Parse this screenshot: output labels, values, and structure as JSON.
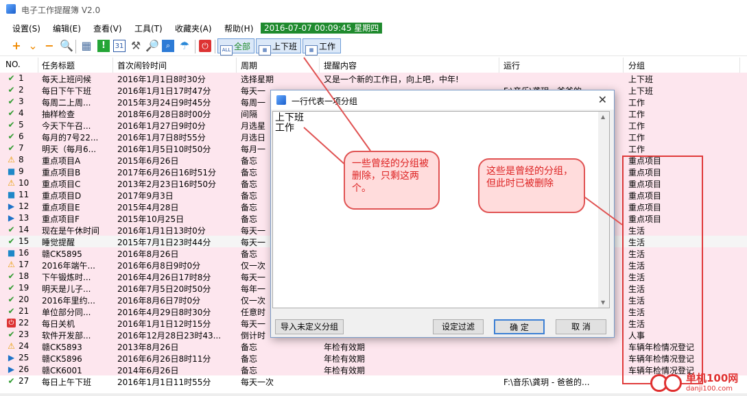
{
  "window": {
    "title": "电子工作提醒簿 V2.0"
  },
  "menu": [
    "设置(S)",
    "编辑(E)",
    "查看(V)",
    "工具(T)",
    "收藏夹(A)",
    "帮助(H)"
  ],
  "clock": "2016-07-07 00:09:45 星期四",
  "toolbar": {
    "buttons": [
      "全部",
      "上下班",
      "工作"
    ],
    "icons": [
      "add-icon",
      "dropdown-icon",
      "remove-icon",
      "search-icon",
      "calendar-icon",
      "exclamation-icon",
      "date31-icon",
      "tools-icon",
      "find-doc-icon",
      "search-blue-icon",
      "weather-icon",
      "power-icon"
    ]
  },
  "columns": [
    "NO.",
    "任务标题",
    "首次闹铃时间",
    "周期",
    "提醒内容",
    "运行",
    "分组"
  ],
  "rows": [
    {
      "no": "1",
      "status": "check",
      "title": "每天上班问候",
      "time": "2016年1月1日8时30分",
      "period": "选择星期",
      "content": "又是一个新的工作日，向上吧，中年!",
      "run": "",
      "group": "上下班"
    },
    {
      "no": "2",
      "status": "check",
      "title": "每日下午下班",
      "time": "2016年1月1日17时47分",
      "period": "每天一",
      "content": "",
      "run": "F:\\音乐\\龚玥 - 爸爸的",
      "group": "上下班"
    },
    {
      "no": "3",
      "status": "check",
      "title": "每周二上周...",
      "time": "2015年3月24日9时45分",
      "period": "每周一",
      "content": "",
      "run": "",
      "group": "工作"
    },
    {
      "no": "4",
      "status": "check",
      "title": "抽样检查",
      "time": "2018年6月28日8时00分",
      "period": "间隔",
      "content": "",
      "run": "",
      "group": "工作"
    },
    {
      "no": "5",
      "status": "check",
      "title": "今天下午召...",
      "time": "2016年1月27日9时0分",
      "period": "月选星",
      "content": "",
      "run": "",
      "group": "工作"
    },
    {
      "no": "6",
      "status": "check",
      "title": "每月的7号22...",
      "time": "2016年1月7日8时55分",
      "period": "月选日",
      "content": "",
      "run": "",
      "group": "工作"
    },
    {
      "no": "7",
      "status": "check",
      "title": "明天（每月6...",
      "time": "2016年1月5日10时50分",
      "period": "每月一",
      "content": "",
      "run": "",
      "group": "工作"
    },
    {
      "no": "8",
      "status": "warn",
      "title": "重点项目A",
      "time": "2015年6月26日",
      "period": "备忘",
      "content": "",
      "run": "",
      "group": "重点项目"
    },
    {
      "no": "9",
      "status": "square",
      "title": "重点项目B",
      "time": "2017年6月26日16时51分",
      "period": "备忘",
      "content": "",
      "run": "",
      "group": "重点项目"
    },
    {
      "no": "10",
      "status": "warn",
      "title": "重点项目C",
      "time": "2013年2月23日16时50分",
      "period": "备忘",
      "content": "",
      "run": "",
      "group": "重点项目"
    },
    {
      "no": "11",
      "status": "square",
      "title": "重点项目D",
      "time": "2017年9月3日",
      "period": "备忘",
      "content": "",
      "run": "",
      "group": "重点项目"
    },
    {
      "no": "12",
      "status": "play",
      "title": "重点项目E",
      "time": "2015年4月28日",
      "period": "备忘",
      "content": "",
      "run": "",
      "group": "重点项目"
    },
    {
      "no": "13",
      "status": "play",
      "title": "重点项目F",
      "time": "2015年10月25日",
      "period": "备忘",
      "content": "",
      "run": "",
      "group": "重点项目"
    },
    {
      "no": "14",
      "status": "check",
      "title": "现在是午休时间",
      "time": "2016年1月1日13时0分",
      "period": "每天一",
      "content": "",
      "run": "",
      "group": "生活"
    },
    {
      "no": "15",
      "status": "check",
      "title": "睡觉提醒",
      "time": "2015年7月1日23时44分",
      "period": "每天一",
      "content": "",
      "run": "",
      "group": "生活"
    },
    {
      "no": "16",
      "status": "square",
      "title": "赣CK5895",
      "time": "2016年8月26日",
      "period": "备忘",
      "content": "",
      "run": "",
      "group": "生活"
    },
    {
      "no": "17",
      "status": "warn",
      "title": "2016年端午...",
      "time": "2016年6月8日9时0分",
      "period": "仅一次",
      "content": "",
      "run": "",
      "group": "生活"
    },
    {
      "no": "18",
      "status": "check",
      "title": "下午锻炼时...",
      "time": "2016年4月26日17时8分",
      "period": "每天一",
      "content": "",
      "run": "",
      "group": "生活"
    },
    {
      "no": "19",
      "status": "check",
      "title": "明天是儿子...",
      "time": "2016年7月5日20时50分",
      "period": "每年一",
      "content": "",
      "run": "",
      "group": "生活"
    },
    {
      "no": "20",
      "status": "check",
      "title": "2016年里约...",
      "time": "2016年8月6日7时0分",
      "period": "仅一次",
      "content": "",
      "run": "",
      "group": "生活"
    },
    {
      "no": "21",
      "status": "check",
      "title": "单位部分同...",
      "time": "2016年4月29日8时30分",
      "period": "任意时",
      "content": "",
      "run": "",
      "group": "生活"
    },
    {
      "no": "22",
      "status": "power",
      "title": "每日关机",
      "time": "2016年1月1日12时15分",
      "period": "每天一",
      "content": "",
      "run": "",
      "group": "生活"
    },
    {
      "no": "23",
      "status": "check",
      "title": "软件开发部...",
      "time": "2016年12月28日23时43...",
      "period": "倒计时",
      "content": "",
      "run": "",
      "group": "人事"
    },
    {
      "no": "24",
      "status": "warn",
      "title": "赣CK5893",
      "time": "2013年8月26日",
      "period": "备忘",
      "content": "年检有效期",
      "run": "",
      "group": "车辆年检情况登记"
    },
    {
      "no": "25",
      "status": "play",
      "title": "赣CK5896",
      "time": "2016年6月26日8时11分",
      "period": "备忘",
      "content": "年检有效期",
      "run": "",
      "group": "车辆年检情况登记"
    },
    {
      "no": "26",
      "status": "play",
      "title": "赣CK6001",
      "time": "2014年6月26日",
      "period": "备忘",
      "content": "年检有效期",
      "run": "",
      "group": "车辆年检情况登记"
    },
    {
      "no": "27",
      "status": "check",
      "title": "每日上午下班",
      "time": "2016年1月1日11时55分",
      "period": "每天一次",
      "content": "",
      "run": "F:\\音乐\\龚玥 - 爸爸的...",
      "group": ""
    }
  ],
  "dialog": {
    "title": "一行代表一项分组",
    "lines": [
      "上下班",
      "工作"
    ],
    "buttons": {
      "import": "导入未定义分组",
      "filter": "设定过滤",
      "ok": "确 定",
      "cancel": "取 消"
    }
  },
  "annotations": {
    "left": "一些曾经的分组被删除，只剩这两个。",
    "right": "这些是曾经的分组，但此时已被删除"
  },
  "watermark": {
    "line1": "单机100网",
    "line2": "danji100.com"
  }
}
